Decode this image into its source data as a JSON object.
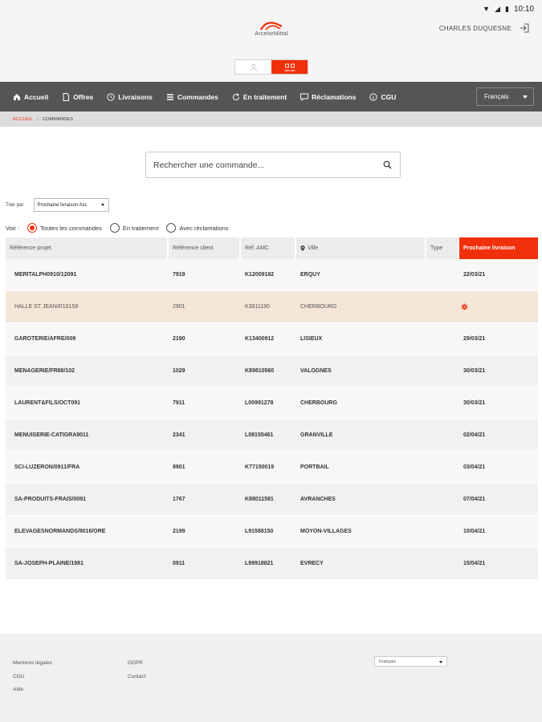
{
  "status_bar": {
    "time": "10:10"
  },
  "header": {
    "logo_text": "ArcelorMittal",
    "user_name": "CHARLES DUQUESNE"
  },
  "nav": {
    "items": [
      {
        "label": "Accueil",
        "icon": "home-icon"
      },
      {
        "label": "Offres",
        "icon": "document-icon"
      },
      {
        "label": "Livraisons",
        "icon": "clock-icon"
      },
      {
        "label": "Commandes",
        "icon": "list-icon"
      },
      {
        "label": "En traitement",
        "icon": "refresh-icon"
      },
      {
        "label": "Réclamations",
        "icon": "chat-icon"
      },
      {
        "label": "CGU",
        "icon": "info-icon"
      }
    ],
    "language": "Français"
  },
  "breadcrumb": {
    "home": "ACCUEIL",
    "separator": "/",
    "current": "COMMANDES"
  },
  "search": {
    "placeholder": "Rechercher une commande..."
  },
  "sort": {
    "label": "Trier par",
    "value": "Prochaine livraison Asc"
  },
  "filter": {
    "label": "Voir :",
    "options": [
      "Toutes les commandes",
      "En traitement",
      "Avec réclamations"
    ],
    "selected": 0
  },
  "table": {
    "headers": [
      "Référence projet",
      "Référence client",
      "Réf. AMC",
      "Ville",
      "Type",
      "Prochaine livraison"
    ],
    "rows": [
      [
        "MERITALPH0910/12091",
        "7919",
        "K12009182",
        "ERQUY",
        "",
        "22/03/21"
      ],
      [
        "HALLE ST JEAN/R10158",
        "2901",
        "K3911190",
        "CHERBOURG",
        "",
        ""
      ],
      [
        "GAROTERIE/AFRE/009",
        "2190",
        "K13400912",
        "LISIEUX",
        "",
        "29/03/21"
      ],
      [
        "MENAGERIE/FR88/102",
        "1029",
        "K89810560",
        "VALOGNES",
        "",
        "30/03/21"
      ],
      [
        "LAURENT&FILS/OCT091",
        "7911",
        "L00991278",
        "CHERBOURG",
        "",
        "30/03/21"
      ],
      [
        "MENUISERIE-CATIGRA9011",
        "2341",
        "L08155461",
        "GRANVILLE",
        "",
        "02/04/21"
      ],
      [
        "SCI-LUZERON/0911/FRA",
        "8901",
        "K77150019",
        "PORTBAIL",
        "",
        "03/04/21"
      ],
      [
        "SA-PRODUITS-FRAIS/0091",
        "1767",
        "K88011581",
        "AVRANCHES",
        "",
        "07/04/21"
      ],
      [
        "ELEVAGESNORMANDS/9016/ORE",
        "2199",
        "L91588150",
        "MOYON-VILLAGES",
        "",
        "10/04/21"
      ],
      [
        "SA-JOSEPH-PLAINE/1981",
        "0911",
        "L99918821",
        "EVRECY",
        "",
        "15/04/21"
      ]
    ]
  },
  "footer": {
    "links_col1": [
      "Mentions légales",
      "CGU",
      "Aide"
    ],
    "links_col2": [
      "GDPR",
      "Contact"
    ],
    "language": "Français"
  },
  "colors": {
    "accent": "#f0300a",
    "nav_bg": "#555555",
    "highlight_row": "#f3e6d6"
  }
}
